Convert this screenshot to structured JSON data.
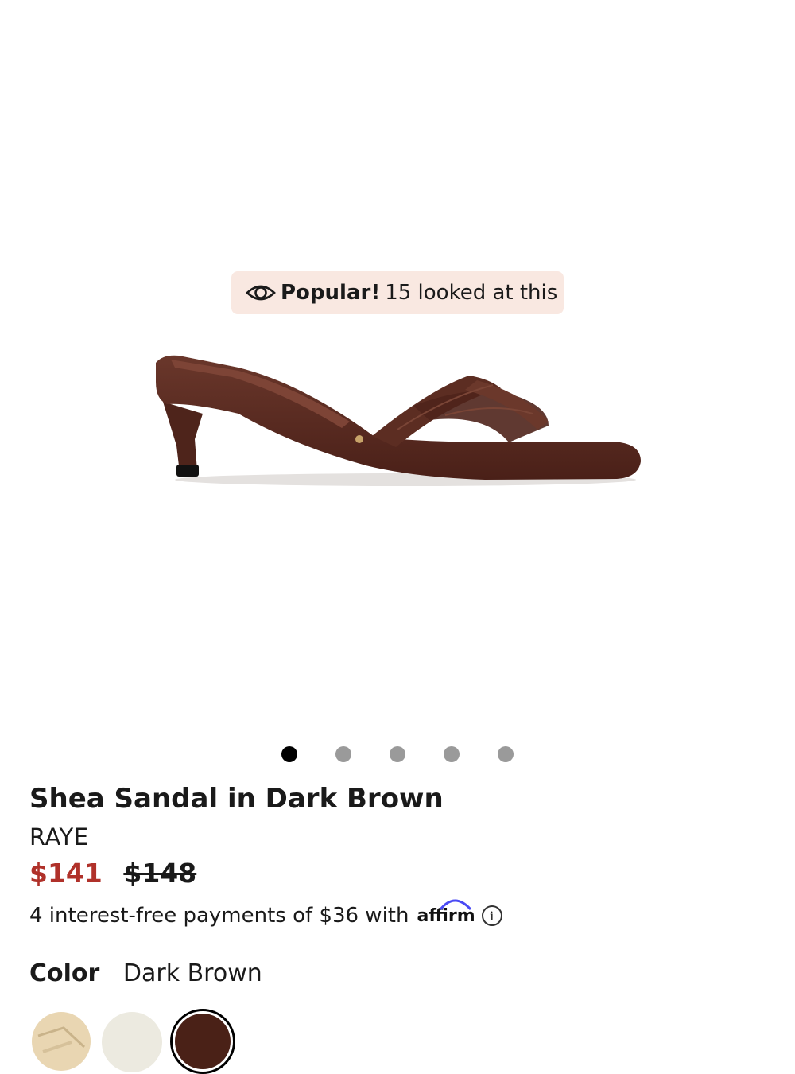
{
  "product": {
    "title": "Shea Sandal in Dark Brown",
    "brand": "RAYE",
    "price_sale": "$141",
    "price_original": "$148",
    "installments_text": "4 interest-free payments of $36 with",
    "affirm_logo": "affirm",
    "info_icon": "i"
  },
  "popular": {
    "label": "Popular!",
    "text": "15 looked at this",
    "icon": "eye-icon"
  },
  "carousel": {
    "total": 5,
    "active": 1
  },
  "color": {
    "label": "Color",
    "selected": "Dark Brown",
    "swatches": [
      {
        "name": "natural",
        "color": "#e9d6b2"
      },
      {
        "name": "cream",
        "color": "#eceae0"
      },
      {
        "name": "dark-brown",
        "color": "#4a2117"
      }
    ]
  },
  "colors": {
    "sale_price": "#b0312a",
    "badge_bg": "#f9e8e1",
    "sandal": "#5a2c21"
  }
}
